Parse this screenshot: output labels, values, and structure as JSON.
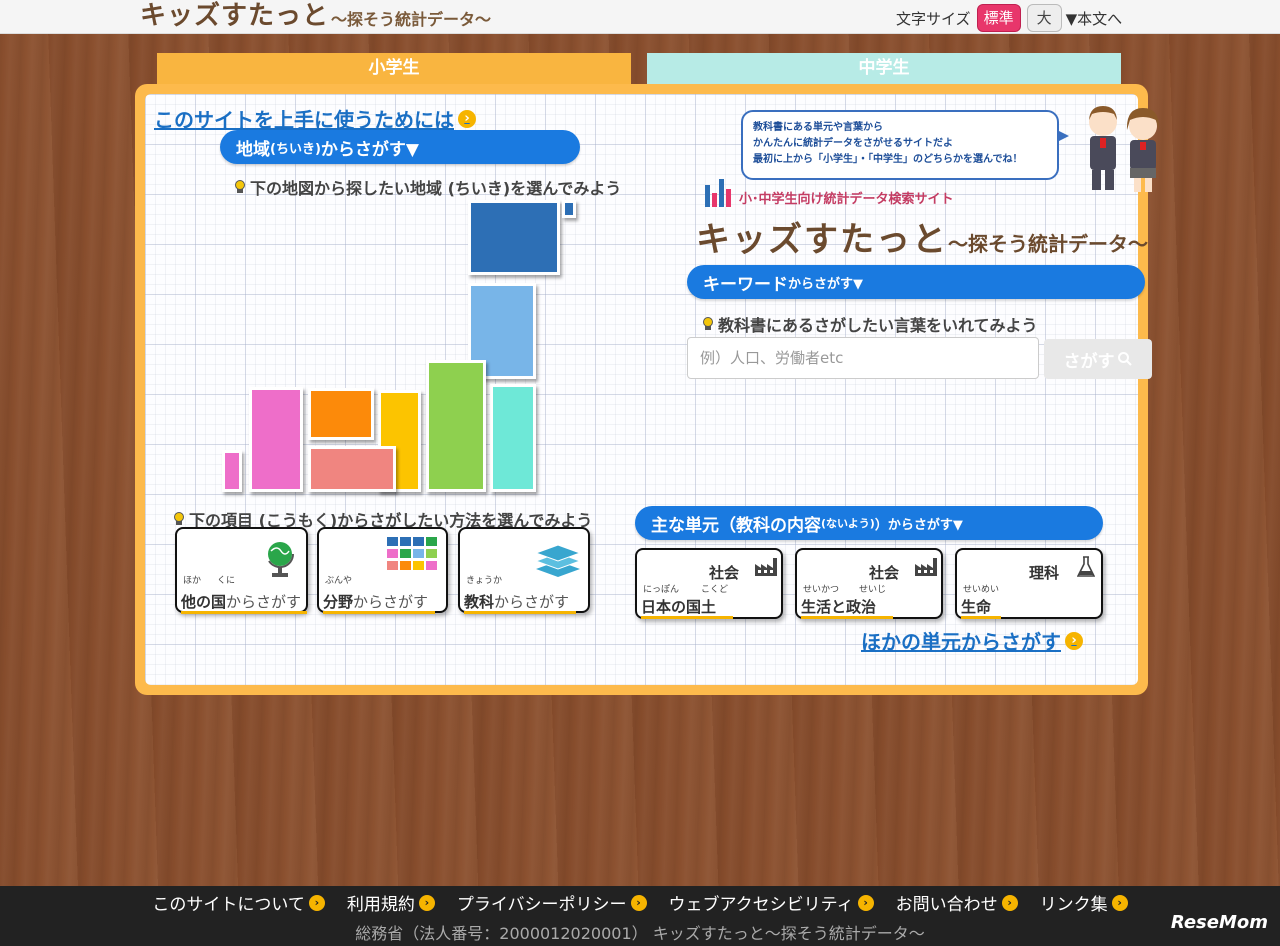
{
  "header": {
    "logo_main": "キッズすたっと",
    "logo_sub": "～探そう統計データ～",
    "fontsize_label": "文字サイズ",
    "fontsize_standard": "標準",
    "fontsize_large": "大",
    "skip_to_main": "▼本文へ"
  },
  "tabs": {
    "elementary": "小学生",
    "junior_high": "中学生"
  },
  "how_to_use": "このサイトを上手に使うためには",
  "area": {
    "head_main": "地域",
    "head_ruby": "(ちいき)",
    "head_tail": "からさがす▼",
    "hint": "下の地図から探したい地域 (ちいき)を選んでみよう"
  },
  "bubble": {
    "line1": "教科書にある単元や言葉から",
    "line2": "かんたんに統計データをさがせるサイトだよ",
    "line3": "最初に上から「小学生」・「中学生」のどちらかを選んでね！"
  },
  "site_tag": "小･中学生向け統計データ検索サイト",
  "big_logo": {
    "main": "キッズすたっと",
    "sub": "～探そう統計データ～"
  },
  "keyword": {
    "head_main": "キーワード",
    "head_tail": "からさがす▼",
    "hint": "教科書にあるさがしたい言葉をいれてみよう",
    "placeholder": "例）人口、労働者etc",
    "search_label": "さがす"
  },
  "items": {
    "hint": "下の項目 (こうもく)からさがしたい方法を選んでみよう",
    "cards": [
      {
        "ruby1": "ほか",
        "ruby2": "くに",
        "main": "他の国",
        "tail": "からさがす"
      },
      {
        "ruby1": "ぶんや",
        "ruby2": "",
        "main": "分野",
        "tail": "からさがす"
      },
      {
        "ruby1": "きょうか",
        "ruby2": "",
        "main": "教科",
        "tail": "からさがす"
      }
    ]
  },
  "units": {
    "head_main": "主な単元（教科の内容",
    "head_ruby": "(ないよう)",
    "head_tail": "）からさがす▼",
    "cards": [
      {
        "subject": "社会",
        "ruby1": "にっぽん",
        "ruby2": "こくど",
        "title": "日本の国土"
      },
      {
        "subject": "社会",
        "ruby1": "せいかつ",
        "ruby2": "せいじ",
        "title": "生活と政治"
      },
      {
        "subject": "理科",
        "ruby1": "せいめい",
        "ruby2": "",
        "title": "生命"
      }
    ],
    "more": "ほかの単元からさがす"
  },
  "footer": {
    "links": [
      "このサイトについて",
      "利用規約",
      "プライバシーポリシー",
      "ウェブアクセシビリティ",
      "お問い合わせ",
      "リンク集"
    ],
    "copyright": "総務省（法人番号：2000012020001） キッズすたっと～探そう統計データ～",
    "watermark": "ReseMom"
  },
  "colors": {
    "board": "#fdba4c",
    "accent_blue": "#1a7ae0",
    "tab_mid": "#b7ebe6",
    "standard_btn": "#e8366b"
  }
}
